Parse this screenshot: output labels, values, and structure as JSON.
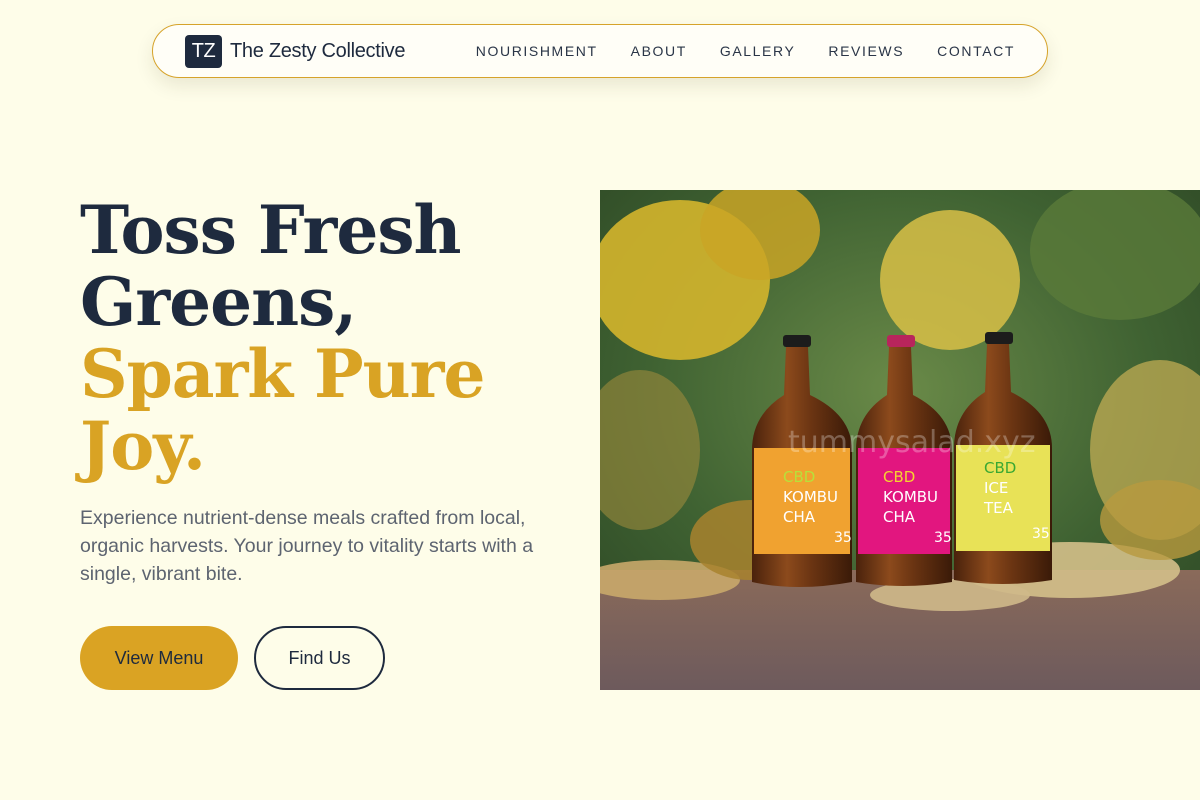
{
  "brand": {
    "logo_initials": "TZ",
    "name": "The Zesty Collective"
  },
  "nav": {
    "links": [
      "NOURISHMENT",
      "ABOUT",
      "GALLERY",
      "REVIEWS",
      "CONTACT"
    ]
  },
  "hero": {
    "headline_line1": "Toss Fresh",
    "headline_line2": "Greens,",
    "headline_line3": "Spark Pure",
    "headline_line4": "Joy.",
    "subtext": "Experience nutrient-dense meals crafted from local, organic harvests. Your journey to vitality starts with a single, vibrant bite.",
    "primary_button": "View Menu",
    "secondary_button": "Find Us"
  },
  "photo": {
    "watermark": "tummysalad.xyz",
    "bottles": [
      {
        "line1": "CBD",
        "line2": "KOMBU",
        "line3": "CHA",
        "number": "35"
      },
      {
        "line1": "CBD",
        "line2": "KOMBU",
        "line3": "CHA",
        "number": "35"
      },
      {
        "line1": "CBD",
        "line2": "ICE",
        "line3": "TEA",
        "number": "35"
      }
    ]
  },
  "colors": {
    "background": "#fefde9",
    "navy": "#1e2a3e",
    "gold": "#d9a324"
  }
}
